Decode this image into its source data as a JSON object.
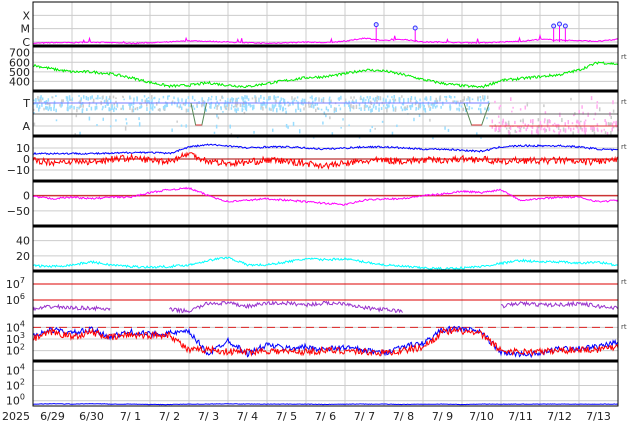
{
  "chart_data": {
    "type": "line",
    "title": "",
    "year_label": "2025",
    "x_tick_labels": [
      "6/29",
      "6/30",
      "7/ 1",
      "7/ 2",
      "7/ 3",
      "7/ 4",
      "7/ 5",
      "7/ 6",
      "7/ 7",
      "7/ 8",
      "7/ 9",
      "7/10",
      "7/11",
      "7/12",
      "7/13"
    ],
    "x_sampling": "half-day keyframes from 6/29 00:00 to 7/14 00:00",
    "panels": [
      {
        "id": "xray",
        "ytick_labels": [
          "X",
          "M",
          "C"
        ],
        "yticks_log10": [
          -4,
          -5,
          -6
        ],
        "ylim_log10": [
          -6.3,
          -3.0
        ],
        "rt": "",
        "series": [
          {
            "name": "X-ray flux",
            "color": "#ff00ff",
            "values": [
              -6.1,
              -6.05,
              -6.05,
              -6.0,
              -6.05,
              -6.1,
              -6.05,
              -6.0,
              -5.9,
              -5.95,
              -6.0,
              -6.05,
              -6.1,
              -6.05,
              -6.0,
              -6.05,
              -5.95,
              -5.7,
              -5.9,
              -5.8,
              -6.0,
              -6.0,
              -6.05,
              -6.05,
              -6.0,
              -5.95,
              -5.8,
              -5.85,
              -5.9,
              -5.95,
              -5.8
            ]
          }
        ],
        "flares": [
          {
            "day": 8.8,
            "log10": -4.7
          },
          {
            "day": 9.8,
            "log10": -4.95
          },
          {
            "day": 13.35,
            "log10": -4.8
          },
          {
            "day": 13.5,
            "log10": -4.65
          },
          {
            "day": 13.65,
            "log10": -4.8
          }
        ]
      },
      {
        "id": "speed",
        "ytick_labels": [
          "700",
          "600",
          "500",
          "400"
        ],
        "yticks": [
          700,
          600,
          500,
          400
        ],
        "ylim": [
          300,
          760
        ],
        "rt": "rt",
        "series": [
          {
            "name": "Solar wind speed",
            "color": "#00ee00",
            "values": [
              570,
              530,
              500,
              500,
              480,
              440,
              390,
              350,
              360,
              385,
              360,
              345,
              380,
              410,
              440,
              450,
              480,
              520,
              510,
              470,
              420,
              380,
              355,
              340,
              410,
              430,
              450,
              470,
              520,
              600,
              580
            ]
          }
        ]
      },
      {
        "id": "imf-sector",
        "ytick_labels": [
          "T",
          "A"
        ],
        "rt": "rt",
        "series": [
          {
            "name": "Toward",
            "color": "#99ddff"
          },
          {
            "name": "Away",
            "color": "#ffaaee"
          }
        ],
        "sector_dips": [
          {
            "start": 4.05,
            "end": 4.45
          },
          {
            "start": 11.05,
            "end": 11.7
          }
        ],
        "away_after_day": 11.7
      },
      {
        "id": "bz",
        "ytick_labels": [
          "10",
          "0",
          "−10"
        ],
        "yticks": [
          10,
          0,
          -10
        ],
        "ylim": [
          -20,
          20
        ],
        "rt": "rt",
        "series": [
          {
            "name": "Bt",
            "color": "#0000ff",
            "values": [
              5,
              5,
              5,
              5,
              5,
              6,
              6,
              5,
              11,
              13,
              12,
              10,
              11,
              11,
              10,
              9,
              10,
              11,
              11,
              10,
              9,
              9,
              8,
              7,
              11,
              12,
              12,
              12,
              11,
              9,
              8
            ]
          },
          {
            "name": "Bz",
            "color": "#ff0000",
            "values": [
              -1,
              -3,
              -2,
              -3,
              0,
              1,
              -1,
              -2,
              5,
              -2,
              -4,
              -3,
              -1,
              -2,
              -4,
              -6,
              -4,
              -2,
              -1,
              -2,
              -1,
              -1,
              0,
              0,
              -3,
              -1,
              -2,
              -1,
              -3,
              -2,
              -1
            ]
          }
        ]
      },
      {
        "id": "dst",
        "ytick_labels": [
          "0",
          "−50"
        ],
        "yticks": [
          0,
          -50
        ],
        "ylim": [
          -100,
          45
        ],
        "rt": "",
        "series": [
          {
            "name": "Dst",
            "color": "#ff00ff",
            "values": [
              -3,
              -10,
              -5,
              -10,
              -5,
              -5,
              10,
              20,
              25,
              0,
              -20,
              -15,
              -10,
              -15,
              -20,
              -25,
              -30,
              -15,
              -10,
              -10,
              0,
              5,
              15,
              10,
              20,
              -15,
              -10,
              -5,
              -5,
              -20,
              -15
            ]
          }
        ]
      },
      {
        "id": "density",
        "ytick_labels": [
          "40",
          "20"
        ],
        "yticks": [
          40,
          20
        ],
        "ylim": [
          0,
          58
        ],
        "rt": "",
        "series": [
          {
            "name": "Density",
            "color": "#00ffff",
            "values": [
              7,
              6,
              8,
              12,
              8,
              6,
              5,
              6,
              8,
              14,
              18,
              8,
              8,
              12,
              16,
              15,
              16,
              12,
              8,
              6,
              4,
              3,
              4,
              6,
              10,
              14,
              12,
              12,
              10,
              12,
              7
            ]
          }
        ]
      },
      {
        "id": "electrons",
        "ytick_labels": [
          "10^7",
          "10^6"
        ],
        "yticks_log10": [
          7,
          6
        ],
        "ylim_log10": [
          5,
          7.75
        ],
        "rt": "rt",
        "series": [
          {
            "name": "Electron flux",
            "color": "#9933cc",
            "values": [
              5.4,
              5.6,
              5.5,
              5.5,
              5.4,
              null,
              null,
              5.4,
              5.3,
              5.8,
              5.8,
              5.6,
              5.8,
              5.8,
              5.7,
              5.8,
              5.8,
              5.5,
              5.4,
              5.3,
              null,
              null,
              null,
              null,
              5.6,
              5.8,
              5.7,
              5.7,
              5.8,
              5.6,
              5.5
            ]
          }
        ]
      },
      {
        "id": "protons",
        "ytick_labels": [
          "10^4",
          "10^3",
          "10^2"
        ],
        "yticks_log10": [
          4,
          3,
          2
        ],
        "ylim_log10": [
          1.1,
          4.9
        ],
        "rt": "rt",
        "threshold_log10": 4,
        "series": [
          {
            "name": "Protons high",
            "color": "#0000ff",
            "values": [
              3.3,
              3.8,
              3.5,
              3.8,
              3.2,
              3.6,
              3.4,
              3.5,
              3.6,
              1.7,
              2.9,
              1.7,
              2.5,
              2.2,
              2.3,
              2.1,
              2.3,
              2.0,
              1.8,
              2.4,
              2.6,
              3.8,
              3.9,
              3.6,
              1.8,
              1.7,
              1.7,
              2.2,
              2.2,
              2.3,
              2.7
            ]
          },
          {
            "name": "Protons low",
            "color": "#ff0000",
            "values": [
              3.0,
              3.6,
              3.2,
              3.6,
              3.1,
              3.4,
              3.3,
              3.4,
              2.0,
              2.1,
              1.9,
              1.9,
              2.0,
              1.9,
              1.9,
              2.0,
              2.0,
              1.9,
              1.8,
              2.0,
              2.3,
              3.6,
              3.7,
              3.4,
              2.0,
              1.9,
              1.9,
              2.0,
              2.1,
              2.1,
              2.4
            ]
          }
        ]
      },
      {
        "id": "bottom",
        "ytick_labels": [
          "10^4",
          "10^2",
          "10^0"
        ],
        "yticks_log10": [
          4,
          2,
          0
        ],
        "ylim_log10": [
          -0.7,
          5.1
        ],
        "rt": "",
        "series": [
          {
            "name": "Flux",
            "color": "#0000ff",
            "values": [
              -0.45,
              -0.4,
              -0.45,
              -0.4,
              -0.45,
              -0.45,
              -0.5,
              -0.5,
              -0.45,
              -0.45,
              -0.4,
              -0.45,
              -0.45,
              -0.45,
              -0.45,
              -0.5,
              -0.45,
              -0.45,
              -0.45,
              -0.5,
              -0.45,
              -0.45,
              -0.5,
              -0.45,
              -0.45,
              -0.45,
              -0.45,
              -0.45,
              -0.45,
              -0.45,
              -0.45
            ]
          }
        ]
      }
    ]
  }
}
